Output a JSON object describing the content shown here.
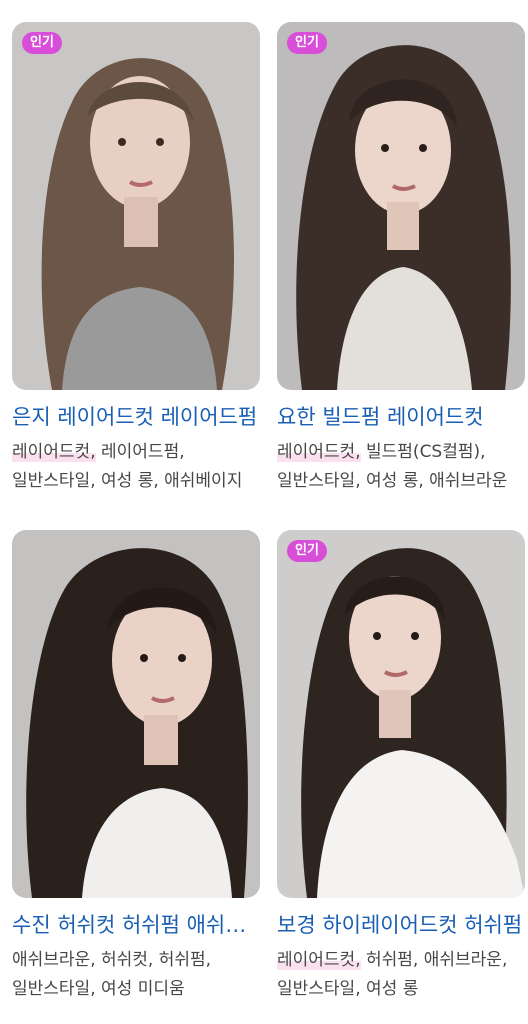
{
  "colors": {
    "badge": "#d94ed9",
    "title": "#1a5fb4",
    "tag_text": "#474747",
    "tag_highlight": "#fbe1ef"
  },
  "cards": [
    {
      "badge": "인기",
      "title": "은지 레이어드컷 레이어드펌",
      "tag_highlight": "레이어드컷,",
      "tags_rest": " 레이어드펌, 일반스타일, 여성 롱, 애쉬베이지",
      "photo_icon": "woman-long-layered-hair-photo"
    },
    {
      "badge": "인기",
      "title": "요한 빌드펌 레이어드컷",
      "tag_highlight": "레이어드컷,",
      "tags_rest": " 빌드펌(CS컬펌), 일반스타일, 여성 롱, 애쉬브라운",
      "photo_icon": "woman-long-layered-hair-photo"
    },
    {
      "badge": "",
      "title": "수진 허쉬컷 허쉬펌 애쉬브라운",
      "tag_highlight": "",
      "tags_rest": "애쉬브라운, 허쉬컷, 허쉬펌, 일반스타일, 여성 미디움",
      "photo_icon": "woman-long-layered-hair-photo"
    },
    {
      "badge": "인기",
      "title": "보경 하이레이어드컷 허쉬펌",
      "tag_highlight": "레이어드컷,",
      "tags_rest": " 허쉬펌, 애쉬브라운, 일반스타일, 여성 롱",
      "photo_icon": "woman-long-layered-hair-photo"
    }
  ]
}
